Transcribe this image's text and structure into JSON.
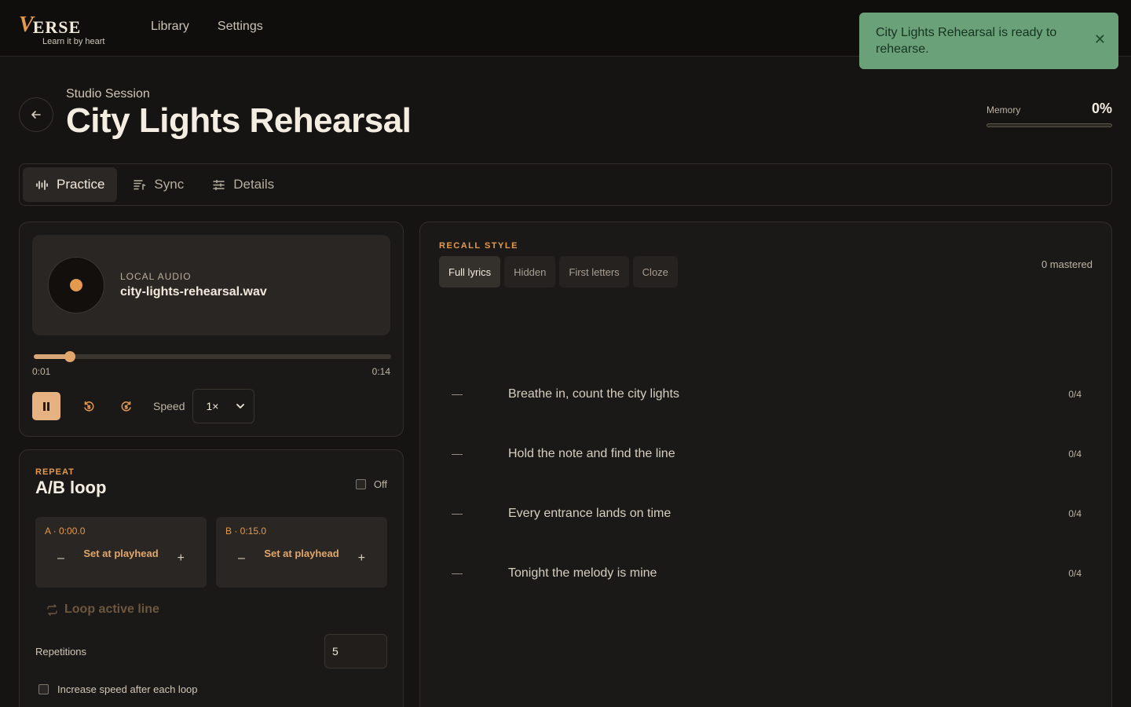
{
  "app": {
    "logo_text": "ERSE",
    "logo_v": "V",
    "tagline": "Learn it by heart"
  },
  "nav": {
    "library": "Library",
    "settings": "Settings"
  },
  "toast": {
    "message": "City Lights Rehearsal is ready to rehearse.",
    "close": "✕"
  },
  "header": {
    "subtitle": "Studio Session",
    "title": "City Lights Rehearsal",
    "memory_label": "Memory",
    "memory_value": "0%"
  },
  "tabs": [
    {
      "label": "Practice",
      "icon": "waveform-icon",
      "active": true
    },
    {
      "label": "Sync",
      "icon": "sync-lyrics-icon",
      "active": false
    },
    {
      "label": "Details",
      "icon": "sliders-icon",
      "active": false
    }
  ],
  "player": {
    "source_label": "LOCAL AUDIO",
    "file_name": "city-lights-rehearsal.wav",
    "current_time": "0:01",
    "duration": "0:14",
    "progress_fraction": 0.1,
    "speed_label": "Speed",
    "speed_value": "1×"
  },
  "loop": {
    "kicker": "REPEAT",
    "title": "A/B loop",
    "toggle_label": "Off",
    "a_label": "A · 0:00.0",
    "b_label": "B · 0:15.0",
    "set_label": "Set at playhead",
    "minus": "–",
    "plus": "+",
    "loop_active": "Loop active line",
    "repetitions_label": "Repetitions",
    "repetitions_value": "5",
    "increase_speed_label": "Increase speed after each loop"
  },
  "recall": {
    "kicker": "RECALL STYLE",
    "styles": [
      "Full lyrics",
      "Hidden",
      "First letters",
      "Cloze"
    ],
    "active_style": "Full lyrics",
    "mastered": "0 mastered",
    "lines": [
      {
        "dash": "—",
        "text": "Breathe in, count the city lights",
        "count": "0/4"
      },
      {
        "dash": "—",
        "text": "Hold the note and find the line",
        "count": "0/4"
      },
      {
        "dash": "—",
        "text": "Every entrance lands on time",
        "count": "0/4"
      },
      {
        "dash": "—",
        "text": "Tonight the melody is mine",
        "count": "0/4"
      }
    ]
  },
  "colors": {
    "accent": "#e39a4f",
    "toast": "#6aa179",
    "background": "#161412"
  }
}
